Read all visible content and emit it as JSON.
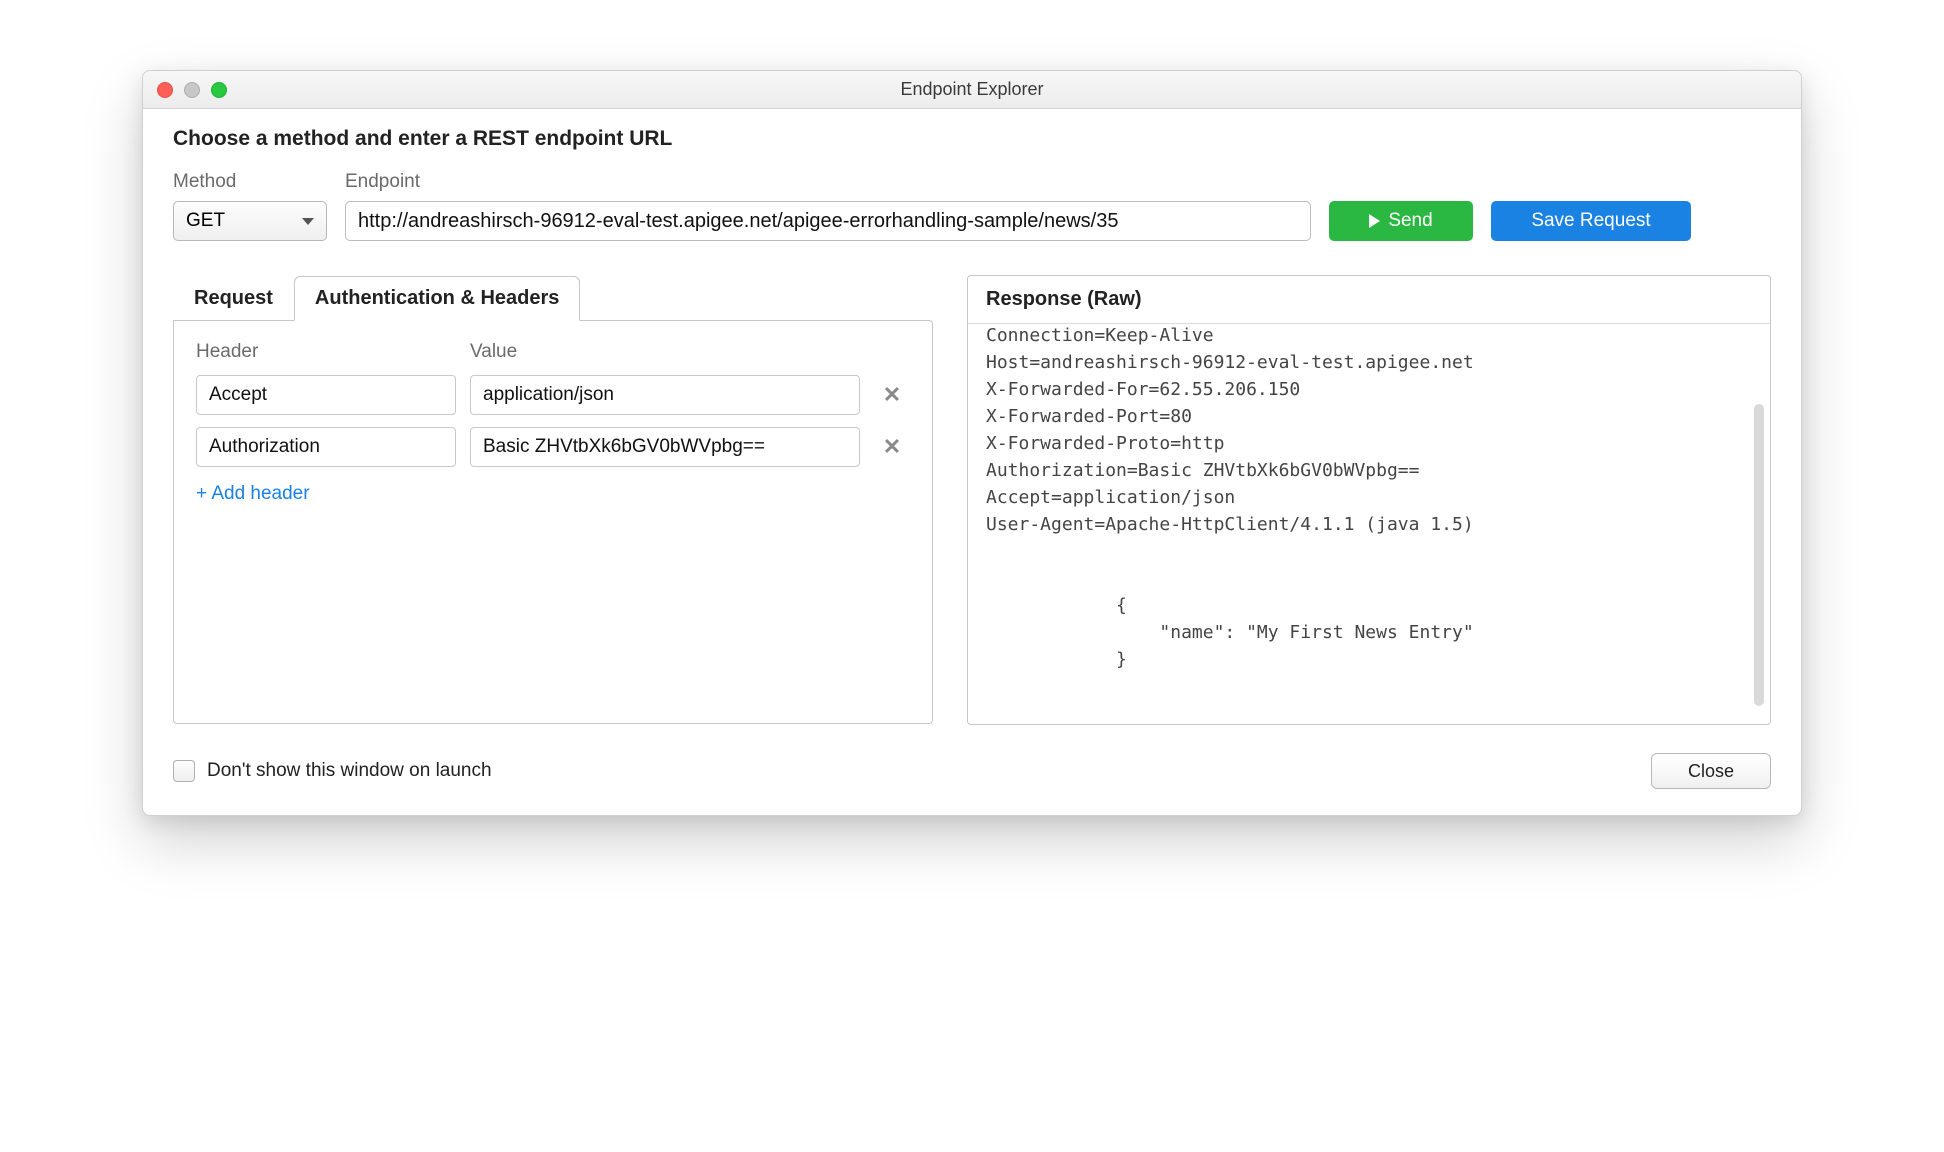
{
  "window": {
    "title": "Endpoint Explorer"
  },
  "instruction": "Choose a method and enter a REST endpoint URL",
  "form": {
    "method_label": "Method",
    "method_value": "GET",
    "endpoint_label": "Endpoint",
    "endpoint_value": "http://andreashirsch-96912-eval-test.apigee.net/apigee-errorhandling-sample/news/35",
    "send_label": "Send",
    "save_label": "Save Request"
  },
  "tabs": {
    "request": "Request",
    "auth_headers": "Authentication & Headers"
  },
  "headers": {
    "col_header": "Header",
    "col_value": "Value",
    "rows": [
      {
        "name": "Accept",
        "value": "application/json"
      },
      {
        "name": "Authorization",
        "value": "Basic ZHVtbXk6bGV0bWVpbg=="
      }
    ],
    "add_label": "+ Add header"
  },
  "response": {
    "title": "Response (Raw)",
    "body": "Connection=Keep-Alive\nHost=andreashirsch-96912-eval-test.apigee.net\nX-Forwarded-For=62.55.206.150\nX-Forwarded-Port=80\nX-Forwarded-Proto=http\nAuthorization=Basic ZHVtbXk6bGV0bWVpbg==\nAccept=application/json\nUser-Agent=Apache-HttpClient/4.1.1 (java 1.5)\n\n\n            {\n                \"name\": \"My First News Entry\"\n            }"
  },
  "footer": {
    "dont_show_label": "Don't show this window on launch",
    "close_label": "Close"
  }
}
